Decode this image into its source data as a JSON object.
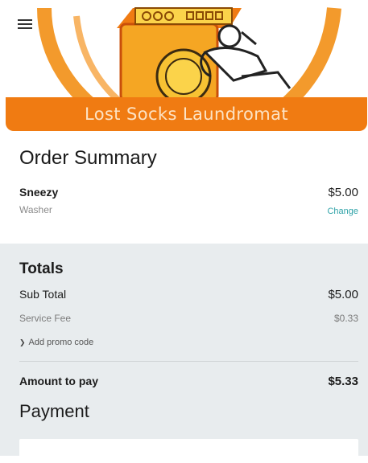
{
  "header": {
    "brand_title": "Lost Socks Laundromat",
    "menu_icon": "hamburger-menu-icon",
    "accent_color": "#f07b12"
  },
  "order_summary": {
    "title": "Order Summary",
    "item": {
      "name": "Sneezy",
      "type": "Washer",
      "price": "$5.00",
      "change_label": "Change"
    }
  },
  "totals": {
    "title": "Totals",
    "sub_total_label": "Sub Total",
    "sub_total_value": "$5.00",
    "service_fee_label": "Service Fee",
    "service_fee_value": "$0.33",
    "promo_label": "Add promo code",
    "amount_label": "Amount to pay",
    "amount_value": "$5.33"
  },
  "payment": {
    "title": "Payment"
  },
  "colors": {
    "link": "#2fa3a8",
    "totals_bg": "#e8ecee"
  }
}
